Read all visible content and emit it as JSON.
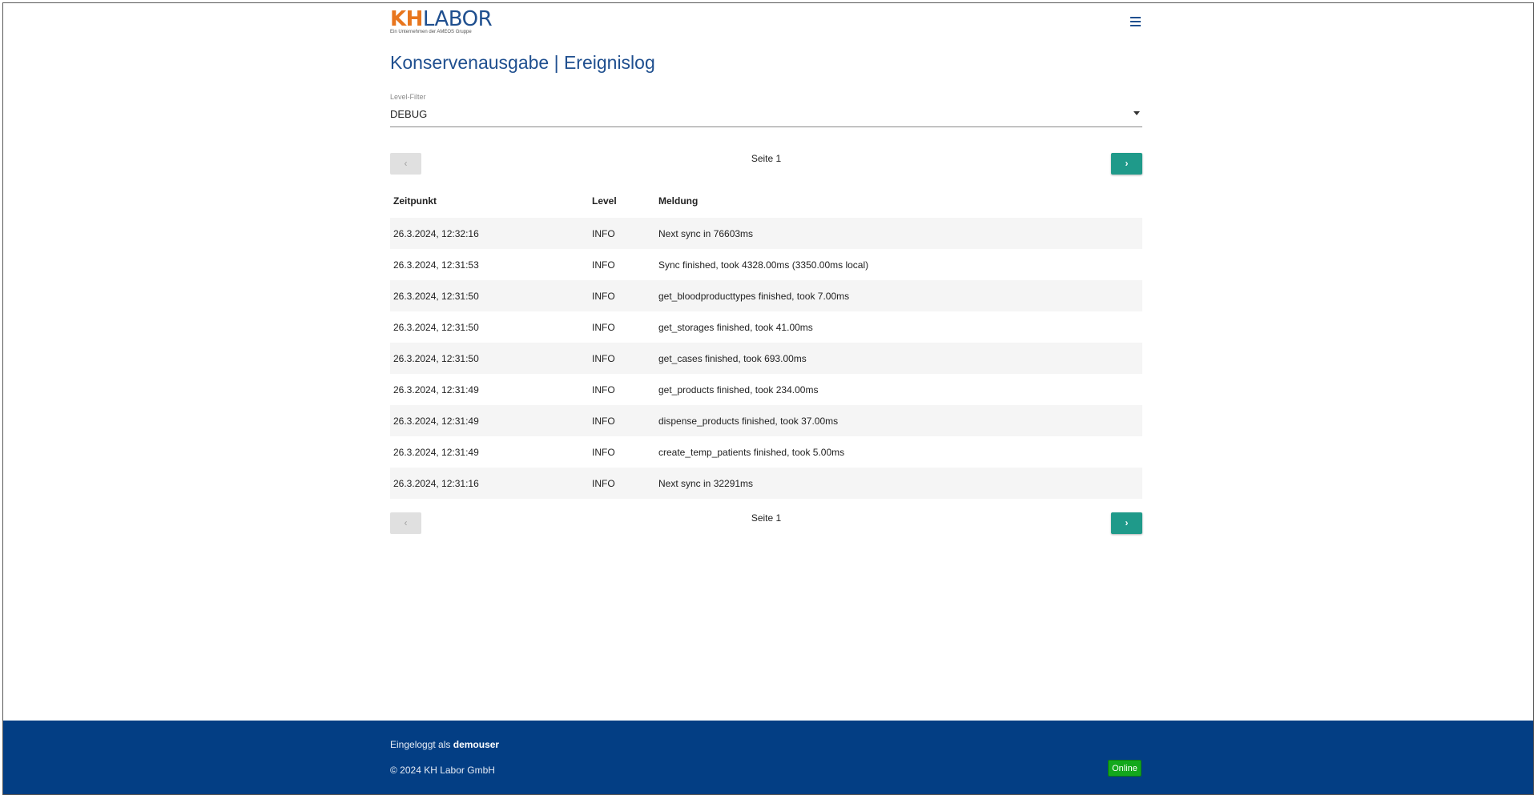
{
  "header": {
    "logo_kh": "KH",
    "logo_labor": "LABOR",
    "logo_sub": "Ein Unternehmen der AMEOS Gruppe",
    "menu_icon": "hamburger-menu-icon"
  },
  "page": {
    "title": "Konservenausgabe | Ereignislog"
  },
  "filter": {
    "label": "Level-Filter",
    "value": "DEBUG",
    "icon": "caret-down-icon"
  },
  "pagination": {
    "prev_label": "‹",
    "next_label": "›",
    "page_text": "Seite 1"
  },
  "table": {
    "columns": [
      "Zeitpunkt",
      "Level",
      "Meldung"
    ],
    "rows": [
      {
        "time": "26.3.2024, 12:32:16",
        "level": "INFO",
        "message": "Next sync in 76603ms"
      },
      {
        "time": "26.3.2024, 12:31:53",
        "level": "INFO",
        "message": "Sync finished, took 4328.00ms (3350.00ms local)"
      },
      {
        "time": "26.3.2024, 12:31:50",
        "level": "INFO",
        "message": "get_bloodproducttypes finished, took 7.00ms"
      },
      {
        "time": "26.3.2024, 12:31:50",
        "level": "INFO",
        "message": "get_storages finished, took 41.00ms"
      },
      {
        "time": "26.3.2024, 12:31:50",
        "level": "INFO",
        "message": "get_cases finished, took 693.00ms"
      },
      {
        "time": "26.3.2024, 12:31:49",
        "level": "INFO",
        "message": "get_products finished, took 234.00ms"
      },
      {
        "time": "26.3.2024, 12:31:49",
        "level": "INFO",
        "message": "dispense_products finished, took 37.00ms"
      },
      {
        "time": "26.3.2024, 12:31:49",
        "level": "INFO",
        "message": "create_temp_patients finished, took 5.00ms"
      },
      {
        "time": "26.3.2024, 12:31:16",
        "level": "INFO",
        "message": "Next sync in 32291ms"
      }
    ]
  },
  "footer": {
    "logged_in_prefix": "Eingeloggt als ",
    "username": "demouser",
    "copyright": "© 2024 KH Labor GmbH",
    "status": "Online"
  },
  "colors": {
    "brand_blue": "#1f4f8f",
    "brand_orange": "#e8761e",
    "footer_blue": "#033e84",
    "accent_teal": "#1f9a8a",
    "online_green": "#13a81c"
  }
}
